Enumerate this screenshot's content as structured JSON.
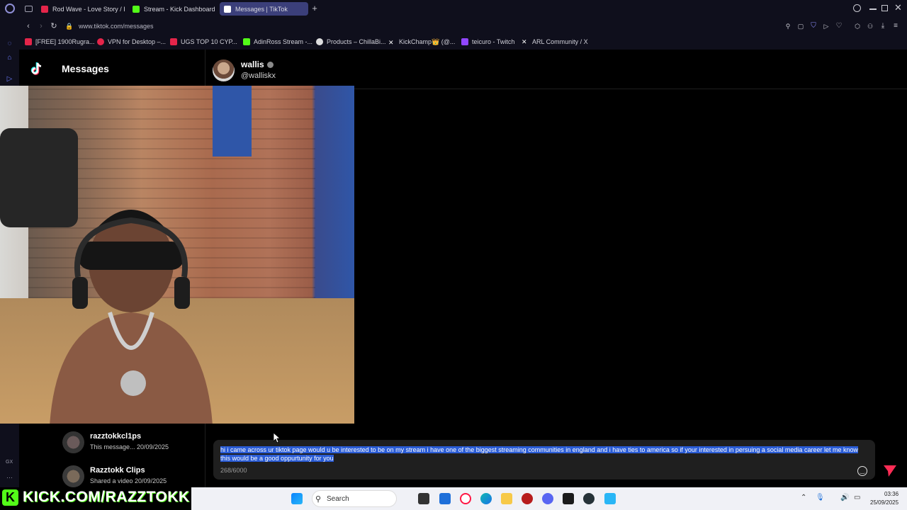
{
  "browser": {
    "tabs": [
      {
        "label": "Rod Wave - Love Story / I",
        "color": "#e4254a"
      },
      {
        "label": "Stream - Kick Dashboard",
        "color": "#53fc18"
      },
      {
        "label": "Messages | TikTok",
        "color": "#ffffff"
      }
    ],
    "url": "www.tiktok.com/messages",
    "bookmarks": [
      {
        "label": "[FREE] 1900Rugra...",
        "color": "#e4254a"
      },
      {
        "label": "VPN for Desktop –...",
        "color": "#e4254a"
      },
      {
        "label": "UGS TOP 10 CYP...",
        "color": "#e4254a"
      },
      {
        "label": "AdinRoss Stream -...",
        "color": "#53fc18"
      },
      {
        "label": "Products – ChillaBi...",
        "color": "#ffffff"
      },
      {
        "label": "KickChamp👑 (@...",
        "color": "#ffffff"
      },
      {
        "label": "teicuro - Twitch",
        "color": "#9146ff"
      },
      {
        "label": "ARL Community / X",
        "color": "#ffffff"
      }
    ]
  },
  "tiktok": {
    "logo_icon": "tiktok-logo-icon",
    "title": "Messages",
    "recipient": {
      "name": "wallis",
      "handle": "@walliskx"
    },
    "chats": [
      {
        "name": "razztokkcl1ps",
        "preview": "This message... 20/09/2025"
      },
      {
        "name": "Razztokk Clips",
        "preview": "Shared a video 20/09/2025"
      }
    ],
    "message": {
      "text": "hi i came across ur tiktok page would u be interested to be on my stream i have one of the biggest streaming communities in england and i have ties to america so if your interested in persuing a social media career let me know this would be a good oppurtunity for you",
      "char_count": "268/6000"
    }
  },
  "overlay": {
    "banner": "KICK.COM/RAZZTOKK",
    "sidebar_label": "GX"
  },
  "taskbar": {
    "search_placeholder": "Search",
    "time": "03:36",
    "date": "25/09/2025"
  },
  "colors": {
    "kick_green": "#53fc18",
    "send_red": "#fe2c55",
    "highlight_blue": "#2a5cd6"
  }
}
